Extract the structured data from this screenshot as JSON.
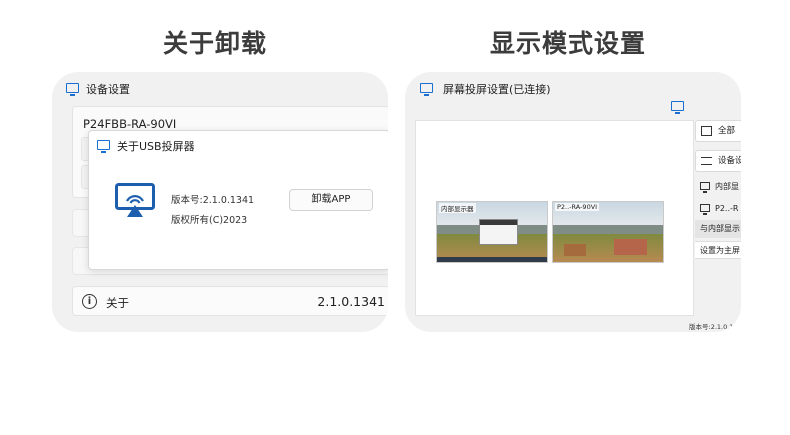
{
  "headings": {
    "left": "关于卸载",
    "right": "显示模式设置"
  },
  "left_panel": {
    "window_title": "设备设置",
    "device_name": "P24FBB-RA-90VI",
    "dialog": {
      "title": "关于USB投屏器",
      "version_line": "版本号:2.1.0.1341",
      "copyright_line": "版权所有(C)2023",
      "uninstall_label": "卸载APP"
    },
    "side_glyphs": [
      "☆",
      "⌘"
    ],
    "about_row": {
      "label": "关于",
      "version": "2.1.0.1341",
      "icon": "info-icon"
    }
  },
  "right_panel": {
    "window_title": "屏幕投屏设置(已连接)",
    "thumbnails": [
      {
        "label": "内部显示器"
      },
      {
        "label": "P2..-RA-90VI"
      }
    ],
    "side_buttons": [
      {
        "label": "全部",
        "icon": "layout-icon"
      },
      {
        "label": "设备设",
        "icon": "settings-icon"
      }
    ],
    "side_items": [
      {
        "label": "内部显",
        "icon": "monitor-icon"
      },
      {
        "label": "P2..-R",
        "icon": "monitor-icon"
      },
      {
        "label": "与内部显示",
        "selected": true
      },
      {
        "label": "设置为主屏"
      }
    ],
    "footer_version": "版本号:2.1.0.1"
  },
  "colors": {
    "accent": "#1a6fd0",
    "card_bg": "#f1f1f1",
    "heading": "#3c3c3c"
  }
}
